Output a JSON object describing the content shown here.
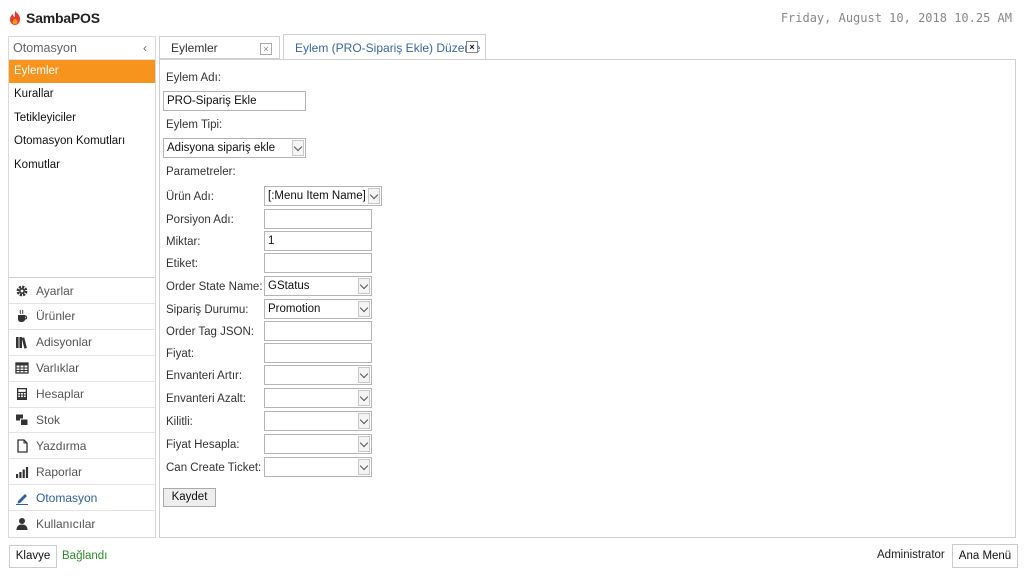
{
  "app": {
    "name": "SambaPOS",
    "datetime": "Friday, August 10, 2018 10.25 AM"
  },
  "sidebar": {
    "title": "Otomasyon",
    "collapse_icon": "chevron-left-icon",
    "items": [
      {
        "label": "Eylemler",
        "active": true
      },
      {
        "label": "Kurallar"
      },
      {
        "label": "Tetikleyiciler"
      },
      {
        "label": "Otomasyon Komutları"
      },
      {
        "label": "Komutlar"
      }
    ],
    "modules": [
      {
        "label": "Ayarlar",
        "icon": "gear-icon"
      },
      {
        "label": "Ürünler",
        "icon": "coffee-cup-icon"
      },
      {
        "label": "Adisyonlar",
        "icon": "books-icon"
      },
      {
        "label": "Varlıklar",
        "icon": "table-icon"
      },
      {
        "label": "Hesaplar",
        "icon": "calculator-icon"
      },
      {
        "label": "Stok",
        "icon": "boxes-icon"
      },
      {
        "label": "Yazdırma",
        "icon": "document-icon"
      },
      {
        "label": "Raporlar",
        "icon": "bar-chart-icon"
      },
      {
        "label": "Otomasyon",
        "icon": "pencil-icon",
        "active": true
      },
      {
        "label": "Kullanıcılar",
        "icon": "user-icon"
      }
    ]
  },
  "tabs": [
    {
      "label": "Eylemler",
      "close": "×"
    },
    {
      "label": "Eylem (PRO-Sipariş Ekle) Düzenle",
      "close": "×",
      "active": true
    }
  ],
  "form": {
    "action_name_label": "Eylem Adı:",
    "action_name_value": "PRO-Sipariş Ekle",
    "action_type_label": "Eylem Tipi:",
    "action_type_value": "Adisyona sipariş ekle",
    "params_label": "Parametreler:",
    "params": [
      {
        "label": "Ürün Adı:",
        "value": "[:Menu Item Name]",
        "type": "select"
      },
      {
        "label": "Porsiyon Adı:",
        "value": "",
        "type": "text"
      },
      {
        "label": "Miktar:",
        "value": "1",
        "type": "text"
      },
      {
        "label": "Etiket:",
        "value": "",
        "type": "text"
      },
      {
        "label": "Order State Name:",
        "value": "GStatus",
        "type": "select"
      },
      {
        "label": "Sipariş Durumu:",
        "value": "Promotion",
        "type": "select"
      },
      {
        "label": "Order Tag JSON:",
        "value": "",
        "type": "text"
      },
      {
        "label": "Fiyat:",
        "value": "",
        "type": "text"
      },
      {
        "label": "Envanteri Artır:",
        "value": "",
        "type": "select"
      },
      {
        "label": "Envanteri Azalt:",
        "value": "",
        "type": "select"
      },
      {
        "label": "Kilitli:",
        "value": "",
        "type": "select"
      },
      {
        "label": "Fiyat Hesapla:",
        "value": "",
        "type": "select"
      },
      {
        "label": "Can Create Ticket:",
        "value": "",
        "type": "select"
      }
    ],
    "save_label": "Kaydet"
  },
  "footer": {
    "keyboard_label": "Klavye",
    "status": "Bağlandı",
    "user": "Administrator",
    "main_menu_label": "Ana Menü"
  },
  "colors": {
    "accent": "#f7941d",
    "active_module": "#2f5f9e",
    "status_ok": "#2a8a2a",
    "tab_active_text": "#3a66a8"
  }
}
